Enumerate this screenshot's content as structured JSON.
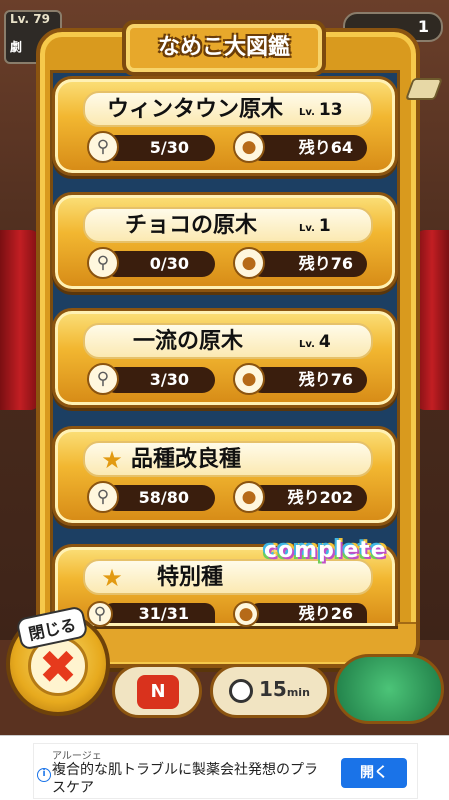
{
  "header": {
    "level_label": "Lv. 79",
    "level_sub": "劇",
    "top_right_counter": "1",
    "title": "なめこ大図鑑"
  },
  "entries": [
    {
      "name": "ウィンタウン原木",
      "lv_prefix": "Lv.",
      "lv": "13",
      "found": "5/30",
      "remaining": "残り64",
      "star": false
    },
    {
      "name": "チョコの原木",
      "lv_prefix": "Lv.",
      "lv": "1",
      "found": "0/30",
      "remaining": "残り76",
      "star": false
    },
    {
      "name": "一流の原木",
      "lv_prefix": "Lv.",
      "lv": "4",
      "found": "3/30",
      "remaining": "残り76",
      "star": false
    },
    {
      "name": "品種改良種",
      "lv_prefix": "",
      "lv": "",
      "found": "58/80",
      "remaining": "残り202",
      "star": true
    },
    {
      "name": "特別種",
      "lv_prefix": "",
      "lv": "",
      "found": "31/31",
      "remaining": "残り26",
      "star": true,
      "complete": "complete"
    }
  ],
  "close_button": {
    "label": "閉じる"
  },
  "hud": {
    "nico_label": "N",
    "timer_value": "15",
    "timer_unit": "min"
  },
  "ad": {
    "sponsor": "アルージェ",
    "text": "複合的な肌トラブルに製薬会社発想のプラスケア",
    "cta": "開く"
  },
  "colors": {
    "frame_gold": "#d99a1e",
    "inner_blue": "#1c3f63",
    "pill_brown": "#3a1e0d",
    "close_red": "#e63a1c",
    "ad_blue": "#1a73e8"
  },
  "icons": {
    "found": "magnifier-icon",
    "remaining": "nameko-cluster-icon",
    "star": "star-icon",
    "close": "close-x-icon",
    "timer": "clock-icon",
    "info": "info-icon"
  }
}
